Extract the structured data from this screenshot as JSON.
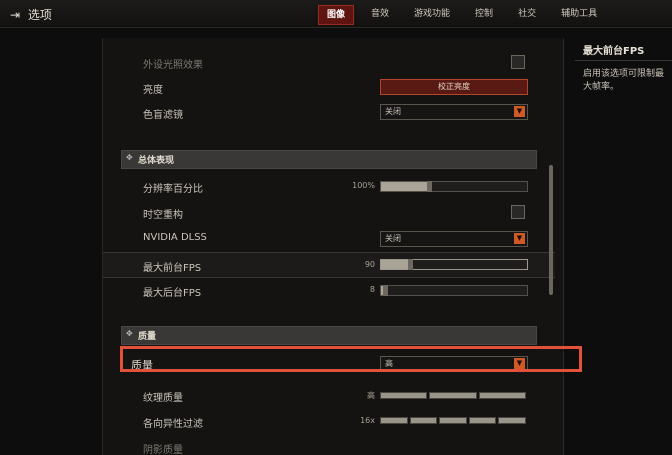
{
  "header": {
    "back_label": "选项",
    "tabs": [
      {
        "label": "图像",
        "active": true
      },
      {
        "label": "音效",
        "active": false
      },
      {
        "label": "游戏功能",
        "active": false
      },
      {
        "label": "控制",
        "active": false
      },
      {
        "label": "社交",
        "active": false
      },
      {
        "label": "辅助工具",
        "active": false
      }
    ]
  },
  "settings": {
    "external_glow_label": "外设光照效果",
    "brightness_label": "亮度",
    "brightness_button": "校正亮度",
    "colorblind_label": "色盲滤镜",
    "colorblind_value": "关闭",
    "section_overall": "总体表现",
    "resolution_label": "分辨率百分比",
    "resolution_value": "100%",
    "resolution_fraction": 0.33,
    "temporal_label": "时空重构",
    "dlss_label": "NVIDIA DLSS",
    "dlss_value": "关闭",
    "max_fg_fps_label": "最大前台FPS",
    "max_fg_fps_value": "90",
    "max_fg_fps_fraction": 0.2,
    "max_bg_fps_label": "最大后台FPS",
    "max_bg_fps_value": "8",
    "max_bg_fps_fraction": 0.03,
    "section_quality": "质量",
    "quality_label": "质量",
    "quality_value": "高",
    "texture_label": "纹理质量",
    "texture_value": "高",
    "aniso_label": "各向异性过滤",
    "aniso_value": "16x",
    "shadow_label": "阴影质量"
  },
  "side_panel": {
    "title": "最大前台FPS",
    "description": "启用该选项可限制最大帧率。"
  },
  "colors": {
    "accent": "#d05a26",
    "active_tab": "#5e1512",
    "highlight_box": "#e2523a"
  }
}
